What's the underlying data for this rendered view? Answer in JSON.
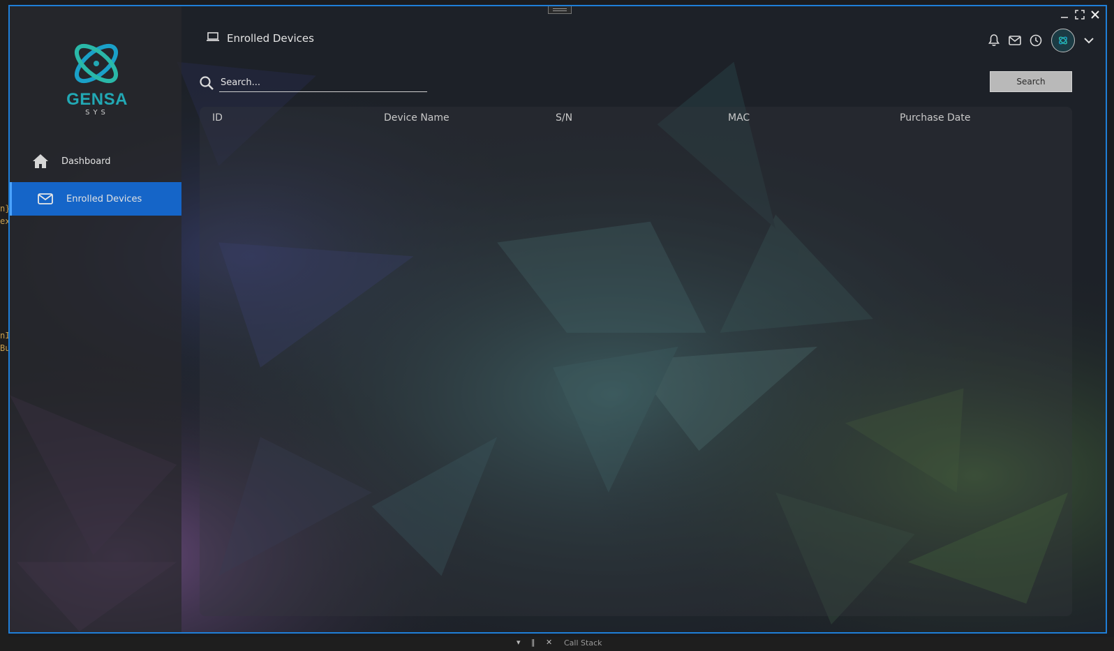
{
  "window": {
    "controls": [
      "minimize",
      "maximize",
      "close"
    ]
  },
  "brand": {
    "name": "GENSA",
    "sub": "SYS",
    "color": "#22a8b4"
  },
  "sidebar": {
    "items": [
      {
        "label": "Dashboard",
        "icon": "home-icon",
        "active": false
      },
      {
        "label": "Enrolled Devices",
        "icon": "mail-icon",
        "active": true
      }
    ]
  },
  "header": {
    "title": "Enrolled Devices",
    "title_icon": "laptop-icon",
    "icons": [
      "bell-icon",
      "mail-icon",
      "clock-icon",
      "avatar",
      "chevron-down-icon"
    ]
  },
  "search": {
    "placeholder": "Search...",
    "value": "",
    "button_label": "Search"
  },
  "table": {
    "columns": [
      "ID",
      "Device Name",
      "S/N",
      "MAC",
      "Purchase Date"
    ],
    "rows": []
  },
  "host": {
    "left_fragments": [
      "n}",
      "ex",
      "nI",
      "Bu"
    ],
    "bottom_text": "Call Stack"
  },
  "colors": {
    "accent": "#1565c8",
    "window_border": "#1f7fd8",
    "brand": "#22a8b4"
  }
}
